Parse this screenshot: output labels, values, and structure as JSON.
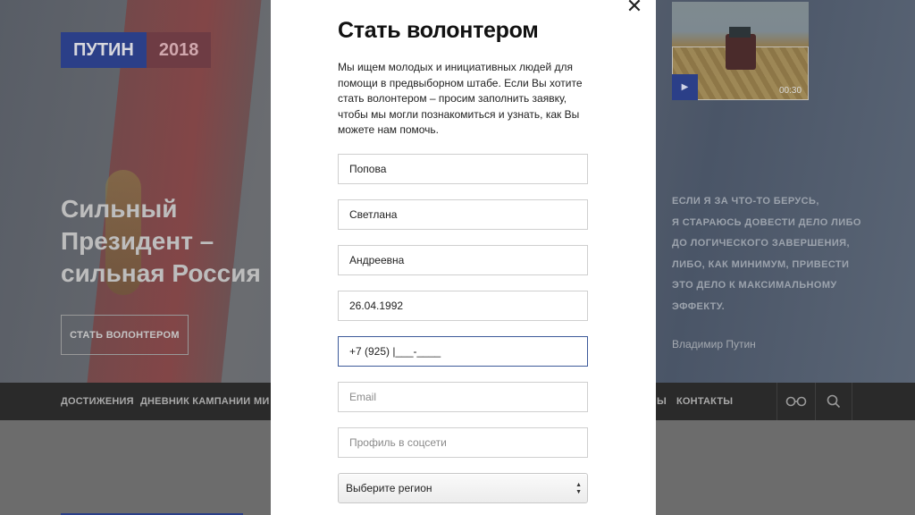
{
  "background": {
    "logo": {
      "name": "ПУТИН",
      "year": "2018"
    },
    "slogan": "Сильный Президент –\nсильная Россия",
    "cta_label": "СТАТЬ ВОЛОНТЕРОМ",
    "video": {
      "duration": "00:30"
    },
    "quote": "ЕСЛИ Я ЗА ЧТО-ТО БЕРУСЬ,\nЯ СТАРАЮСЬ ДОВЕСТИ ДЕЛО ЛИБО\nДО ЛОГИЧЕСКОГО ЗАВЕРШЕНИЯ,\nЛИБО, КАК МИНИМУМ, ПРИВЕСТИ\nЭТО ДЕЛО К МАКСИМАЛЬНОМУ\nЭФФЕКТУ.",
    "quote_author": "Владимир Путин",
    "nav": [
      "ДОСТИЖЕНИЯ",
      "ДНЕВНИК КАМПАНИИ",
      "МИ",
      "Ы",
      "КОНТАКТЫ"
    ],
    "nav_icons": [
      "glasses-icon",
      "search-icon"
    ],
    "colors": {
      "brand_blue": "#2b3f88",
      "brand_red": "#b2343f",
      "nav_bg": "#2a2a2a"
    }
  },
  "modal": {
    "close_label": "✕",
    "title": "Стать волонтером",
    "description": "Мы ищем молодых и инициативных людей для\nпомощи в предвыборном штабе. Если Вы хотите\nстать волонтером – просим заполнить заявку,\nчтобы мы могли познакомиться и узнать, как Вы\nможете нам помочь.",
    "fields": {
      "last_name": "Попова",
      "first_name": "Светлана",
      "patronymic": "Андреевна",
      "birth_date": "26.04.1992",
      "phone": "+7 (925) |___-____",
      "email_placeholder": "Email",
      "social_placeholder": "Профиль в соцсети"
    },
    "region_select": "Выберите регион",
    "colors": {
      "active_border": "#3d5a9a"
    }
  }
}
